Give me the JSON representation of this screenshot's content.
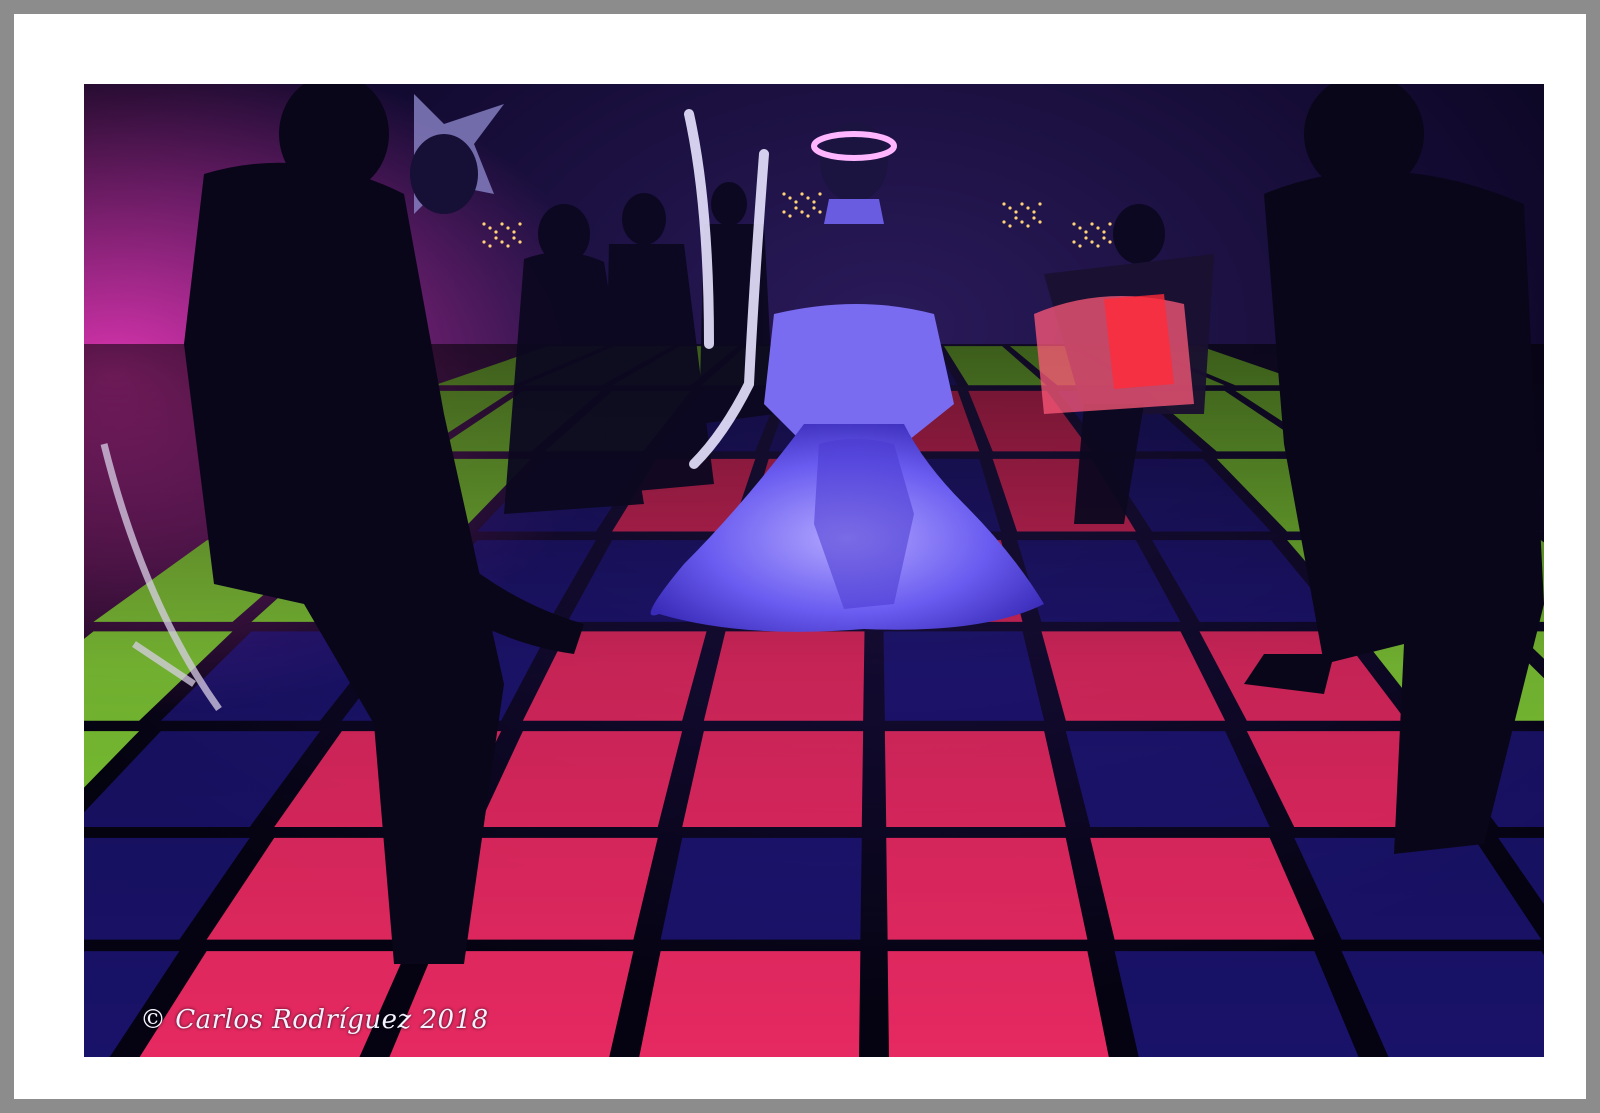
{
  "photo": {
    "watermark": "© Carlos Rodríguez 2018",
    "scene": "dance-floor",
    "colors": {
      "border": "#8c8c8c",
      "mat": "#ffffff",
      "tile_green": "#8fe23a",
      "tile_red": "#ff2d6a",
      "tile_blue": "#2a1fb0",
      "dress_glow": "#7f78ff"
    }
  }
}
